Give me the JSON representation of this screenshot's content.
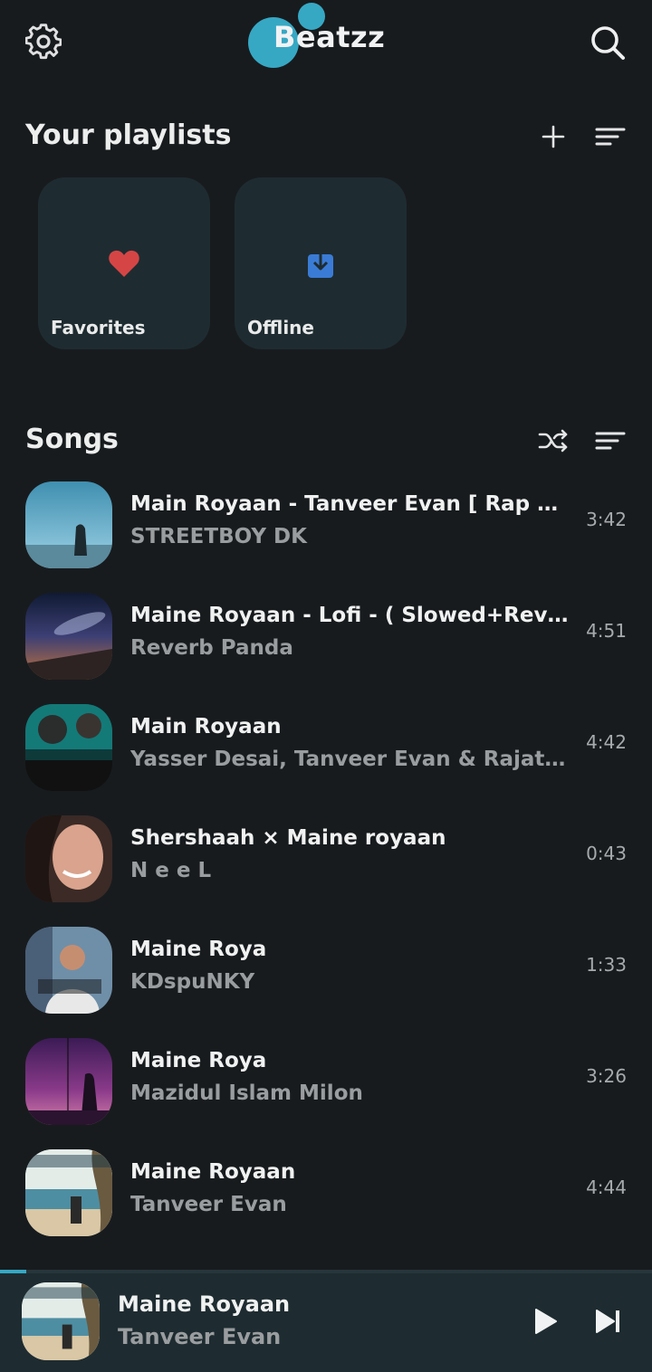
{
  "app": {
    "name": "Beatzz",
    "accent": "#36a8c4"
  },
  "header": {
    "settings_icon": "gear-icon",
    "search_icon": "search-icon"
  },
  "playlists": {
    "title": "Your playlists",
    "items": [
      {
        "label": "Favorites",
        "icon": "heart-icon",
        "icon_color": "#d64545"
      },
      {
        "label": "Offline",
        "icon": "download-icon",
        "icon_color": "#3a7bd5"
      }
    ]
  },
  "songs": {
    "title": "Songs",
    "items": [
      {
        "title": "Main Royaan - Tanveer Evan [ Rap Extended Version ]",
        "artist": "STREETBOY DK",
        "duration": "3:42"
      },
      {
        "title": "Maine Royaan - Lofi - ( Slowed+Reverb )",
        "artist": "Reverb Panda",
        "duration": "4:51"
      },
      {
        "title": "Main Royaan",
        "artist": "Yasser Desai, Tanveer Evan & Rajat Nagpal",
        "duration": "4:42"
      },
      {
        "title": "Shershaah × Maine royaan",
        "artist": "N e e L",
        "duration": "0:43"
      },
      {
        "title": "Maine Roya",
        "artist": "KDspuNKY",
        "duration": "1:33"
      },
      {
        "title": "Maine Roya",
        "artist": "Mazidul Islam Milon",
        "duration": "3:26"
      },
      {
        "title": "Maine Royaan",
        "artist": "Tanveer Evan",
        "duration": "4:44"
      }
    ]
  },
  "now_playing": {
    "title": "Maine Royaan",
    "artist": "Tanveer Evan",
    "progress": 0.04
  }
}
